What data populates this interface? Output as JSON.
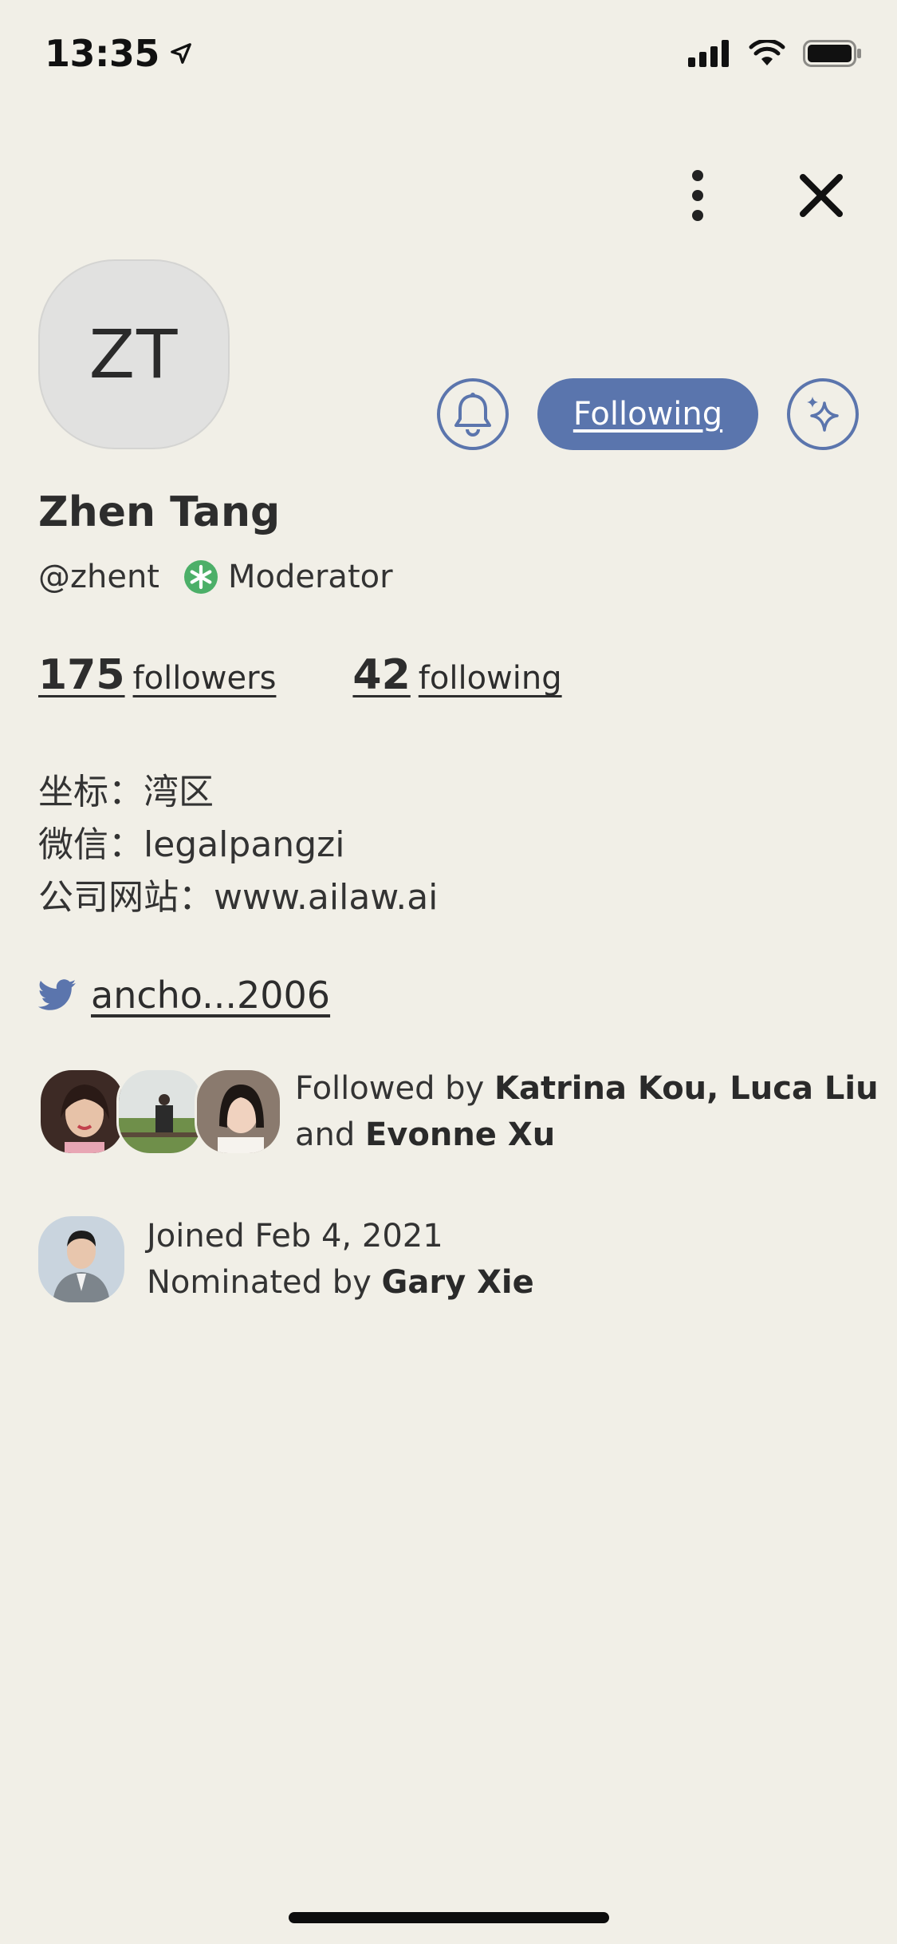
{
  "status_bar": {
    "time": "13:35"
  },
  "profile": {
    "initials": "ZT",
    "name": "Zhen Tang",
    "handle": "@zhent",
    "role": "Moderator",
    "followers_count": "175",
    "followers_label": "followers",
    "following_count": "42",
    "following_label": "following",
    "following_button": "Following"
  },
  "bio": {
    "line1": "坐标：湾区",
    "line2": "微信：legalpangzi",
    "line3": "公司网站：www.ailaw.ai"
  },
  "twitter": {
    "handle": "ancho...2006"
  },
  "followed_by": {
    "prefix": "Followed by ",
    "names_a": "Katrina Kou, Luca Liu",
    "and": " and ",
    "names_b": "Evonne Xu"
  },
  "joined": {
    "text": "Joined Feb 4, 2021",
    "nominated_prefix": "Nominated by ",
    "nominated_name": "Gary Xie"
  },
  "colors": {
    "background": "#f1efe7",
    "accent": "#5a75ad",
    "moderator_green": "#4caf68",
    "text": "#2d2d2d"
  },
  "icons": [
    "location-arrow-icon",
    "signal-icon",
    "wifi-icon",
    "battery-icon",
    "more-vertical-icon",
    "close-icon",
    "bell-icon",
    "sparkle-icon",
    "moderator-icon",
    "twitter-icon"
  ]
}
